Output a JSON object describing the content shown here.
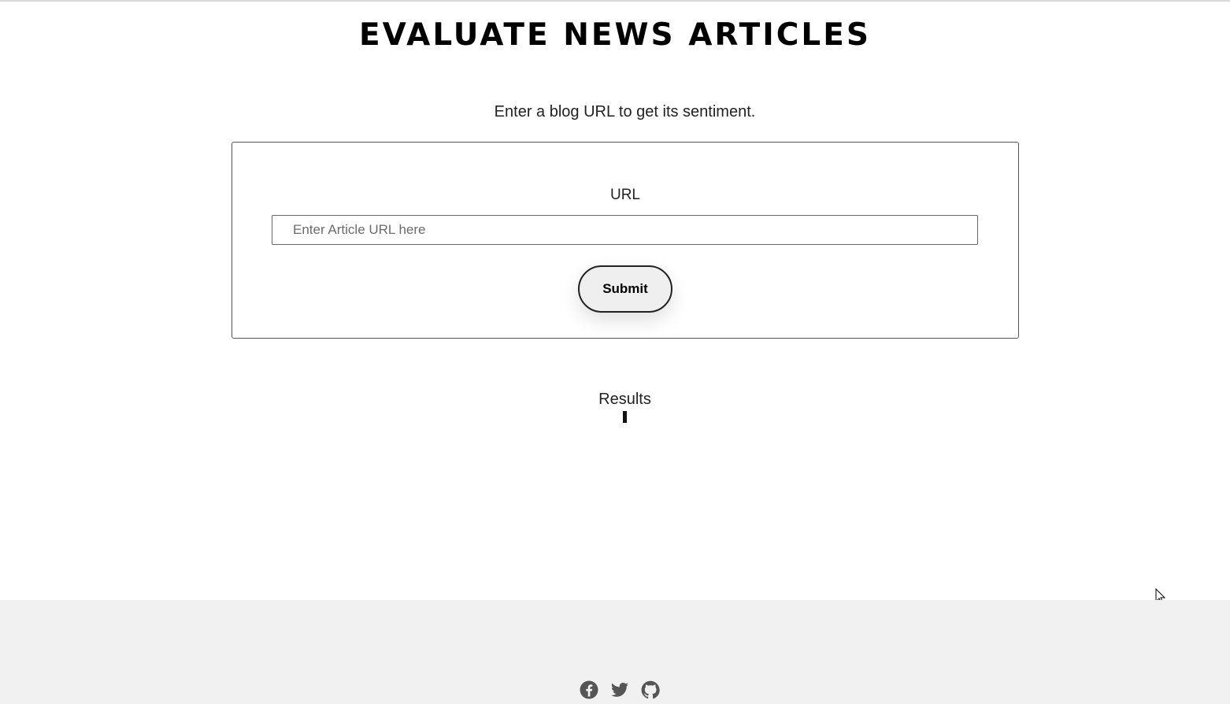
{
  "header": {
    "title": "EVALUATE NEWS ARTICLES"
  },
  "intro": {
    "text": "Enter a blog URL to get its sentiment."
  },
  "form": {
    "url_label": "URL",
    "url_value": "",
    "url_placeholder": "Enter Article URL here",
    "submit_label": "Submit"
  },
  "results": {
    "heading": "Results"
  },
  "footer": {
    "social_icons": [
      "facebook-icon",
      "twitter-icon",
      "github-icon"
    ],
    "background_color": "#f1f1f1"
  }
}
